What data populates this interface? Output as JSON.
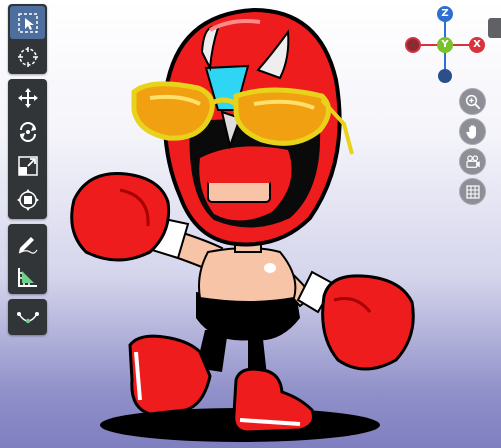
{
  "viewport": {
    "background_top": "#ffffff",
    "background_bottom": "#7f7fc0"
  },
  "toolbar": {
    "tools": [
      {
        "name": "select-box",
        "icon": "select-box-icon",
        "active": true
      },
      {
        "name": "cursor",
        "icon": "cursor-icon",
        "active": false
      },
      {
        "name": "move",
        "icon": "move-icon",
        "active": false
      },
      {
        "name": "rotate",
        "icon": "rotate-icon",
        "active": false
      },
      {
        "name": "scale",
        "icon": "scale-icon",
        "active": false
      },
      {
        "name": "transform",
        "icon": "transform-icon",
        "active": false
      },
      {
        "name": "annotate",
        "icon": "annotate-icon",
        "active": false
      },
      {
        "name": "measure",
        "icon": "measure-icon",
        "active": false
      },
      {
        "name": "shear",
        "icon": "shear-icon",
        "active": false
      }
    ]
  },
  "gizmo": {
    "z_label": "Z",
    "y_label": "Y",
    "x_label": "X",
    "z_color": "#2f6fd0",
    "y_color": "#7ac22b",
    "x_color": "#d8323d"
  },
  "nav_buttons": [
    {
      "name": "zoom",
      "icon": "zoom-icon"
    },
    {
      "name": "pan",
      "icon": "hand-icon"
    },
    {
      "name": "camera",
      "icon": "camera-icon"
    },
    {
      "name": "grid",
      "icon": "grid-icon"
    }
  ]
}
